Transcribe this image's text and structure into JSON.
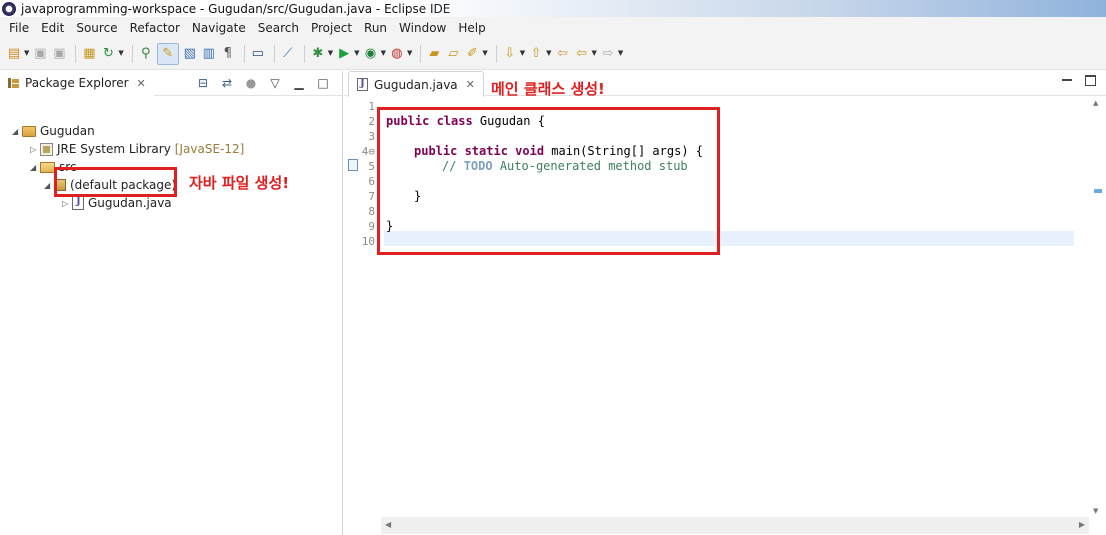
{
  "window": {
    "title": "javaprogramming-workspace - Gugudan/src/Gugudan.java - Eclipse IDE"
  },
  "menubar": {
    "items": [
      "File",
      "Edit",
      "Source",
      "Refactor",
      "Navigate",
      "Search",
      "Project",
      "Run",
      "Window",
      "Help"
    ]
  },
  "toolbar": {
    "icons": [
      "new-icon",
      "save-icon",
      "save-all-icon",
      "new-java-project-icon",
      "refresh-icon",
      "open-type-icon",
      "toggle-mark-occurrences-icon",
      "next-annotation-icon",
      "toggle-block-selection-icon",
      "show-whitespace-icon",
      "terminal-icon",
      "skip-breakpoints-icon",
      "debug-icon",
      "run-icon",
      "coverage-icon",
      "external-tools-icon",
      "new-package-icon",
      "open-folder-icon",
      "search-icon",
      "next-edit-icon",
      "prev-edit-icon",
      "last-edit-icon",
      "back-icon",
      "forward-icon"
    ]
  },
  "package_explorer": {
    "tab_label": "Package Explorer",
    "close_glyph": "✕",
    "tree": [
      {
        "label": "Gugudan",
        "icon": "project-icon",
        "expanded": true
      },
      {
        "label": "JRE System Library",
        "suffix": "[JavaSE-12]",
        "icon": "library-icon",
        "expanded": false
      },
      {
        "label": "src",
        "icon": "source-folder-icon",
        "expanded": true
      },
      {
        "label": "(default package)",
        "icon": "package-icon",
        "expanded": true
      },
      {
        "label": "Gugudan.java",
        "icon": "java-file-icon",
        "expanded": false
      }
    ],
    "annotation": "자바 파일 생성!"
  },
  "editor": {
    "tab_label": "Gugudan.java",
    "close_glyph": "✕",
    "annotation": "메인 클래스 생성!",
    "line_numbers": [
      "1",
      "2",
      "3",
      "4⊖",
      "5",
      "6",
      "7",
      "8",
      "9",
      "10"
    ],
    "code": {
      "l2_kw": "public class",
      "l2_rest": " Gugudan {",
      "l4_kw": "public static void",
      "l4_rest": " main(String[] args) {",
      "l5_comment": "// ",
      "l5_todo": "TODO",
      "l5_rest": " Auto-generated method stub",
      "l7": "}",
      "l9": "}"
    }
  },
  "colors": {
    "annotation": "#e02020",
    "keyword": "#7f0055",
    "comment": "#3f7f5f",
    "current_line": "#e8f2fe"
  }
}
